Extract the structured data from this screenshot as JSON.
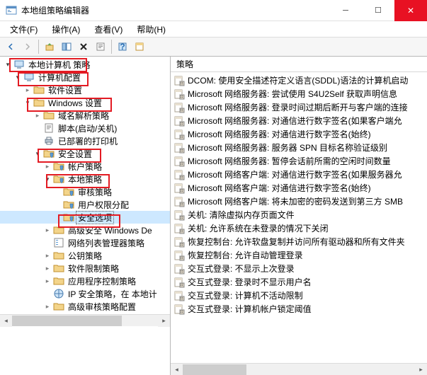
{
  "window": {
    "title": "本地组策略编辑器"
  },
  "menu": {
    "file": "文件(F)",
    "action": "操作(A)",
    "view": "查看(V)",
    "help": "帮助(H)"
  },
  "right": {
    "header": "策略",
    "items": [
      "DCOM: 使用安全描述符定义语言(SDDL)语法的计算机启动",
      "Microsoft 网络服务器: 尝试使用 S4U2Self 获取声明信息",
      "Microsoft 网络服务器: 登录时间过期后断开与客户端的连接",
      "Microsoft 网络服务器: 对通信进行数字签名(如果客户端允",
      "Microsoft 网络服务器: 对通信进行数字签名(始终)",
      "Microsoft 网络服务器: 服务器 SPN 目标名称验证级别",
      "Microsoft 网络服务器: 暂停会话前所需的空闲时间数量",
      "Microsoft 网络客户端: 对通信进行数字签名(如果服务器允",
      "Microsoft 网络客户端: 对通信进行数字签名(始终)",
      "Microsoft 网络客户端: 将未加密的密码发送到第三方 SMB",
      "关机: 清除虚拟内存页面文件",
      "关机: 允许系统在未登录的情况下关闭",
      "恢复控制台: 允许软盘复制并访问所有驱动器和所有文件夹",
      "恢复控制台: 允许自动管理登录",
      "交互式登录: 不显示上次登录",
      "交互式登录: 登录时不显示用户名",
      "交互式登录: 计算机不活动限制",
      "交互式登录: 计算机帐户锁定阈值"
    ]
  },
  "tree": {
    "root": "本地计算机 策略",
    "computer_config": "计算机配置",
    "software_settings": "软件设置",
    "windows_settings": "Windows 设置",
    "dns_policy": "域名解析策略",
    "scripts": "脚本(启动/关机)",
    "deployed_printers": "已部署的打印机",
    "security_settings": "安全设置",
    "account_policies": "帐户策略",
    "local_policies": "本地策略",
    "audit_policy": "审核策略",
    "user_rights": "用户权限分配",
    "security_options": "安全选项",
    "advanced_firewall": "高级安全 Windows De",
    "network_list": "网络列表管理器策略",
    "public_key": "公钥策略",
    "software_restriction": "软件限制策略",
    "app_control": "应用程序控制策略",
    "ip_security": "IP 安全策略，在 本地计",
    "advanced_audit": "高级审核策略配置"
  }
}
